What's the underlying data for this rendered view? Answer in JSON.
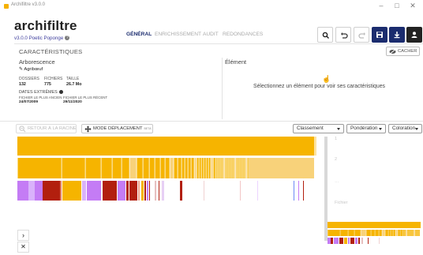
{
  "window": {
    "title": "Archifiltre v3.0.0",
    "controls": [
      "–",
      "□",
      "✕"
    ]
  },
  "header": {
    "brand": "archifiltre",
    "version": "v3.0.0 Poetic Poponge",
    "tabs": [
      {
        "label": "GÉNÉRAL",
        "active": true
      },
      {
        "label": "ENRICHISSEMENT",
        "active": false
      },
      {
        "label": "AUDIT",
        "active": false
      },
      {
        "label": "REDONDANCES",
        "active": false
      }
    ],
    "actions": [
      {
        "name": "search-button",
        "icon": "search-icon",
        "style": "light"
      },
      {
        "name": "undo-button",
        "icon": "undo-icon",
        "style": "light"
      },
      {
        "name": "redo-button",
        "icon": "redo-icon",
        "style": "light"
      },
      {
        "name": "save-button",
        "icon": "save-icon",
        "style": "dark"
      },
      {
        "name": "export-button",
        "icon": "download-icon",
        "style": "dark"
      },
      {
        "name": "user-button",
        "icon": "user-icon",
        "style": "black"
      }
    ]
  },
  "details": {
    "title": "CARACTÉRISTIQUES",
    "hide_label": "CACHER",
    "tree": {
      "title": "Arborescence",
      "node_name": "Agribœuf",
      "stats": {
        "folders_label": "DOSSIERS",
        "folders_value": "132",
        "files_label": "FICHIERS",
        "files_value": "775",
        "size_label": "TAILLE",
        "size_value": "26.7 Mo"
      },
      "dates_title": "DATES EXTRÊMES",
      "oldest_label": "FICHIER LE PLUS ANCIEN",
      "oldest_value": "24/07/2009",
      "newest_label": "FICHIER LE PLUS RÉCENT",
      "newest_value": "29/11/2020"
    },
    "element": {
      "title": "Élément",
      "placeholder": "Sélectionnez un élément pour voir ses caractéristiques"
    }
  },
  "toolbar": {
    "back_label": "RETOUR À LA RACINE",
    "move_label": "MODE DÉPLACEMENT",
    "beta_label": "BETA",
    "sort": {
      "selected": "Classement"
    },
    "weight": {
      "selected": "Pondération"
    },
    "color": {
      "selected": "Coloration"
    }
  },
  "visualization": {
    "level_labels": [
      "1",
      "2",
      "…",
      "Fichier"
    ],
    "colors": {
      "folder": "#f6b400",
      "folder_light": "#f8d27a",
      "presentation": "#b21f0e",
      "image": "#c47cf5",
      "document": "#6d88f5",
      "other": "#bfbfbf"
    },
    "nav": [
      "›",
      "✕"
    ]
  }
}
